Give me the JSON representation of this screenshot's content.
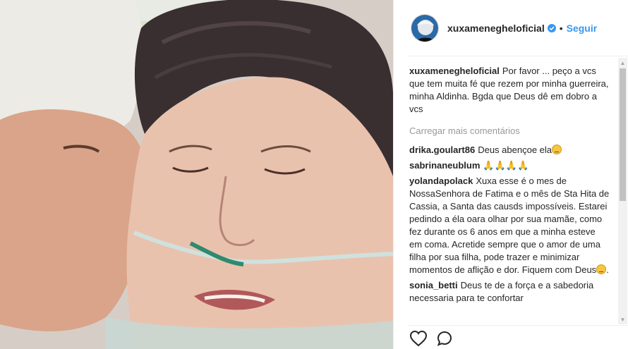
{
  "post": {
    "username": "xuxamenegheloficial",
    "separator": "•",
    "follow_label": "Seguir"
  },
  "caption": {
    "username": "xuxamenegheloficial",
    "text": "Por favor ... peço a vcs que tem muita fé que rezem por minha guerreira, minha Aldinha. Bgda que Deus dê em dobro a vcs"
  },
  "load_more_label": "Carregar mais comentários",
  "comments": [
    {
      "username": "drika.goulart86",
      "text": "Deus abençoe ela"
    },
    {
      "username": "sabrinaneublum",
      "text": "🙏🙏🙏🙏"
    },
    {
      "username": "yolandapolack",
      "text": "Xuxa esse é o mes de NossaSenhora de Fatima e o mês de Sta Hita de Cassia, a Santa das causds impossíveis. Estarei pedindo a éla oara olhar por sua mamãe, como fez durante os 6 anos em que a minha esteve em coma. Acretide sempre que o amor de uma filha por sua filha, pode trazer e minimizar momentos de aflição e dor. Fiquem com Deus"
    },
    {
      "username": "sonia_betti",
      "text": "Deus te de a força e a sabedoria necessaria para te confortar"
    }
  ],
  "icons": {
    "verified": "verified-badge-icon",
    "like": "heart-icon",
    "comment": "comment-icon",
    "scroll_up": "▲",
    "scroll_down": "▼"
  },
  "colors": {
    "follow": "#3897f0",
    "verified": "#3897f0",
    "muted": "#999999"
  }
}
